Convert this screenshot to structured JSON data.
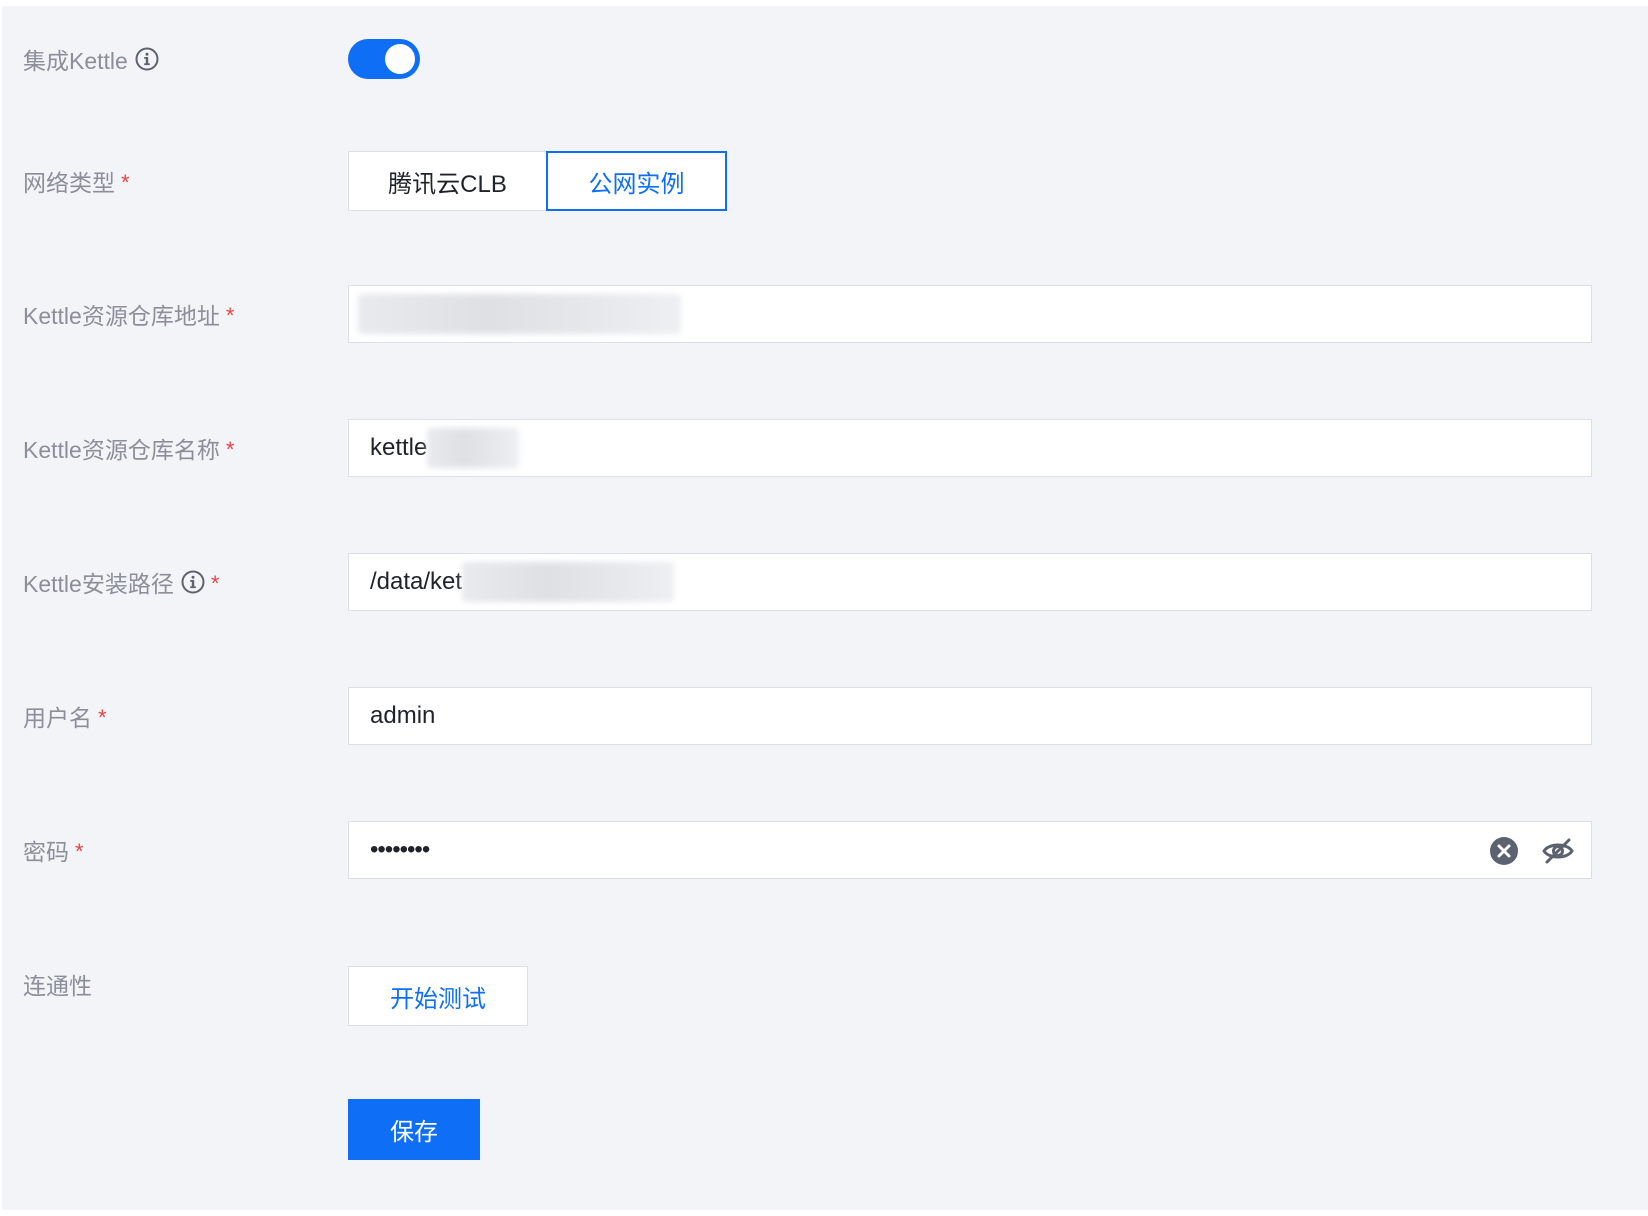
{
  "form": {
    "kettle_integration": {
      "label": "集成Kettle",
      "enabled": true
    },
    "network_type": {
      "label": "网络类型",
      "required_mark": "*",
      "options": [
        "腾讯云CLB",
        "公网实例"
      ],
      "selected": "公网实例"
    },
    "repo_address": {
      "label": "Kettle资源仓库地址",
      "required_mark": "*",
      "value": ""
    },
    "repo_name": {
      "label": "Kettle资源仓库名称",
      "required_mark": "*",
      "value": "kettle"
    },
    "install_path": {
      "label": "Kettle安装路径",
      "required_mark": "*",
      "value": "/data/ket"
    },
    "username": {
      "label": "用户名",
      "required_mark": "*",
      "value": "admin"
    },
    "password": {
      "label": "密码",
      "required_mark": "*",
      "value": "••••••••"
    },
    "connectivity": {
      "label": "连通性",
      "button_label": "开始测试"
    },
    "save_label": "保存"
  },
  "colors": {
    "accent": "#0e6ef5",
    "required": "#e54545",
    "label": "#8a8f99",
    "background": "#f3f4f8"
  },
  "icons": {
    "info": "info-circle-icon",
    "clear": "clear-circle-icon",
    "toggle_visibility": "eye-slash-icon"
  }
}
